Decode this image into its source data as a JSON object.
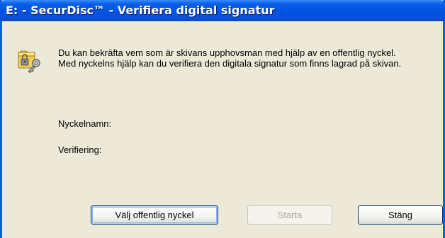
{
  "window": {
    "title": "E: - SecurDisc™ - Verifiera digital signatur"
  },
  "icon": "key-folder-icon",
  "message": {
    "line1": "Du kan bekräfta vem som är skivans upphovsman med hjälp av en offentlig nyckel.",
    "line2": "Med nyckelns hjälp kan du verifiera den digitala signatur som finns lagrad på skivan."
  },
  "fields": {
    "key_name_label": "Nyckelnamn:",
    "verification_label": "Verifiering:"
  },
  "buttons": {
    "choose_key": "Välj offentlig nyckel",
    "start": "Starta",
    "close": "Stäng"
  },
  "colors": {
    "titlebar": "#0054e3",
    "dialog_bg": "#ece9d8"
  }
}
